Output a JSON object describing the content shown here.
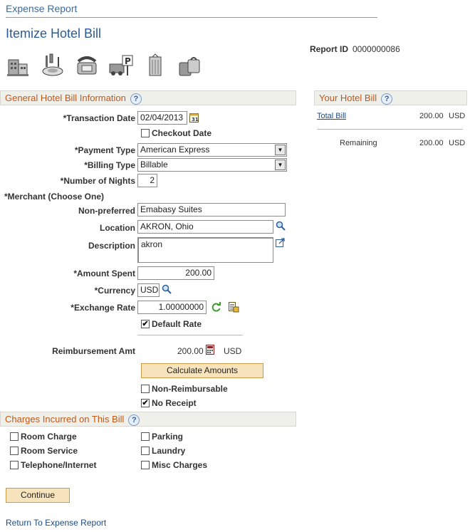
{
  "breadcrumb": "Expense Report",
  "page_title": "Itemize Hotel Bill",
  "report_id": {
    "label": "Report ID",
    "value": "0000000086"
  },
  "category_icons": [
    "building-icon",
    "dining-icon",
    "telephone-icon",
    "parking-icon",
    "laundry-icon",
    "misc-charges-icon"
  ],
  "general_section": {
    "title": "General Hotel Bill Information",
    "help": "?",
    "transaction_date": {
      "label": "*Transaction Date",
      "value": "02/04/2013"
    },
    "checkout_date": {
      "label": "Checkout Date",
      "checked": false
    },
    "payment_type": {
      "label": "*Payment Type",
      "value": "American Express"
    },
    "billing_type": {
      "label": "*Billing Type",
      "value": "Billable"
    },
    "number_of_nights": {
      "label": "*Number of Nights",
      "value": "2"
    },
    "merchant_heading": "*Merchant (Choose One)",
    "non_preferred": {
      "label": "Non-preferred",
      "value": "Emabasy Suites"
    },
    "location": {
      "label": "Location",
      "value": "AKRON, Ohio"
    },
    "description": {
      "label": "Description",
      "value": "akron"
    },
    "amount_spent": {
      "label": "*Amount Spent",
      "value": "200.00"
    },
    "currency": {
      "label": "*Currency",
      "value": "USD"
    },
    "exchange_rate": {
      "label": "*Exchange Rate",
      "value": "1.00000000"
    },
    "default_rate": {
      "label": "Default Rate",
      "checked": true
    },
    "reimbursement": {
      "label": "Reimbursement Amt",
      "value": "200.00",
      "currency": "USD"
    },
    "calculate_button": "Calculate Amounts",
    "non_reimbursable": {
      "label": "Non-Reimbursable",
      "checked": false
    },
    "no_receipt": {
      "label": "No Receipt",
      "checked": true
    }
  },
  "hotel_bill": {
    "title": "Your Hotel Bill",
    "help": "?",
    "total_label": "Total Bill",
    "total_value": "200.00",
    "total_currency": "USD",
    "remaining_label": "Remaining",
    "remaining_value": "200.00",
    "remaining_currency": "USD"
  },
  "charges_section": {
    "title": "Charges Incurred on This Bill",
    "help": "?",
    "items": [
      {
        "label": "Room Charge",
        "checked": false
      },
      {
        "label": "Room Service",
        "checked": false
      },
      {
        "label": "Telephone/Internet",
        "checked": false
      },
      {
        "label": "Parking",
        "checked": false
      },
      {
        "label": "Laundry",
        "checked": false
      },
      {
        "label": "Misc Charges",
        "checked": false
      }
    ]
  },
  "continue_button": "Continue",
  "return_link": "Return To Expense Report",
  "check_mark": "✔",
  "colors": {
    "header_text": "#c2571a",
    "title": "#2b5c95",
    "button": "#f7e4bd",
    "link": "#1e4c82"
  }
}
